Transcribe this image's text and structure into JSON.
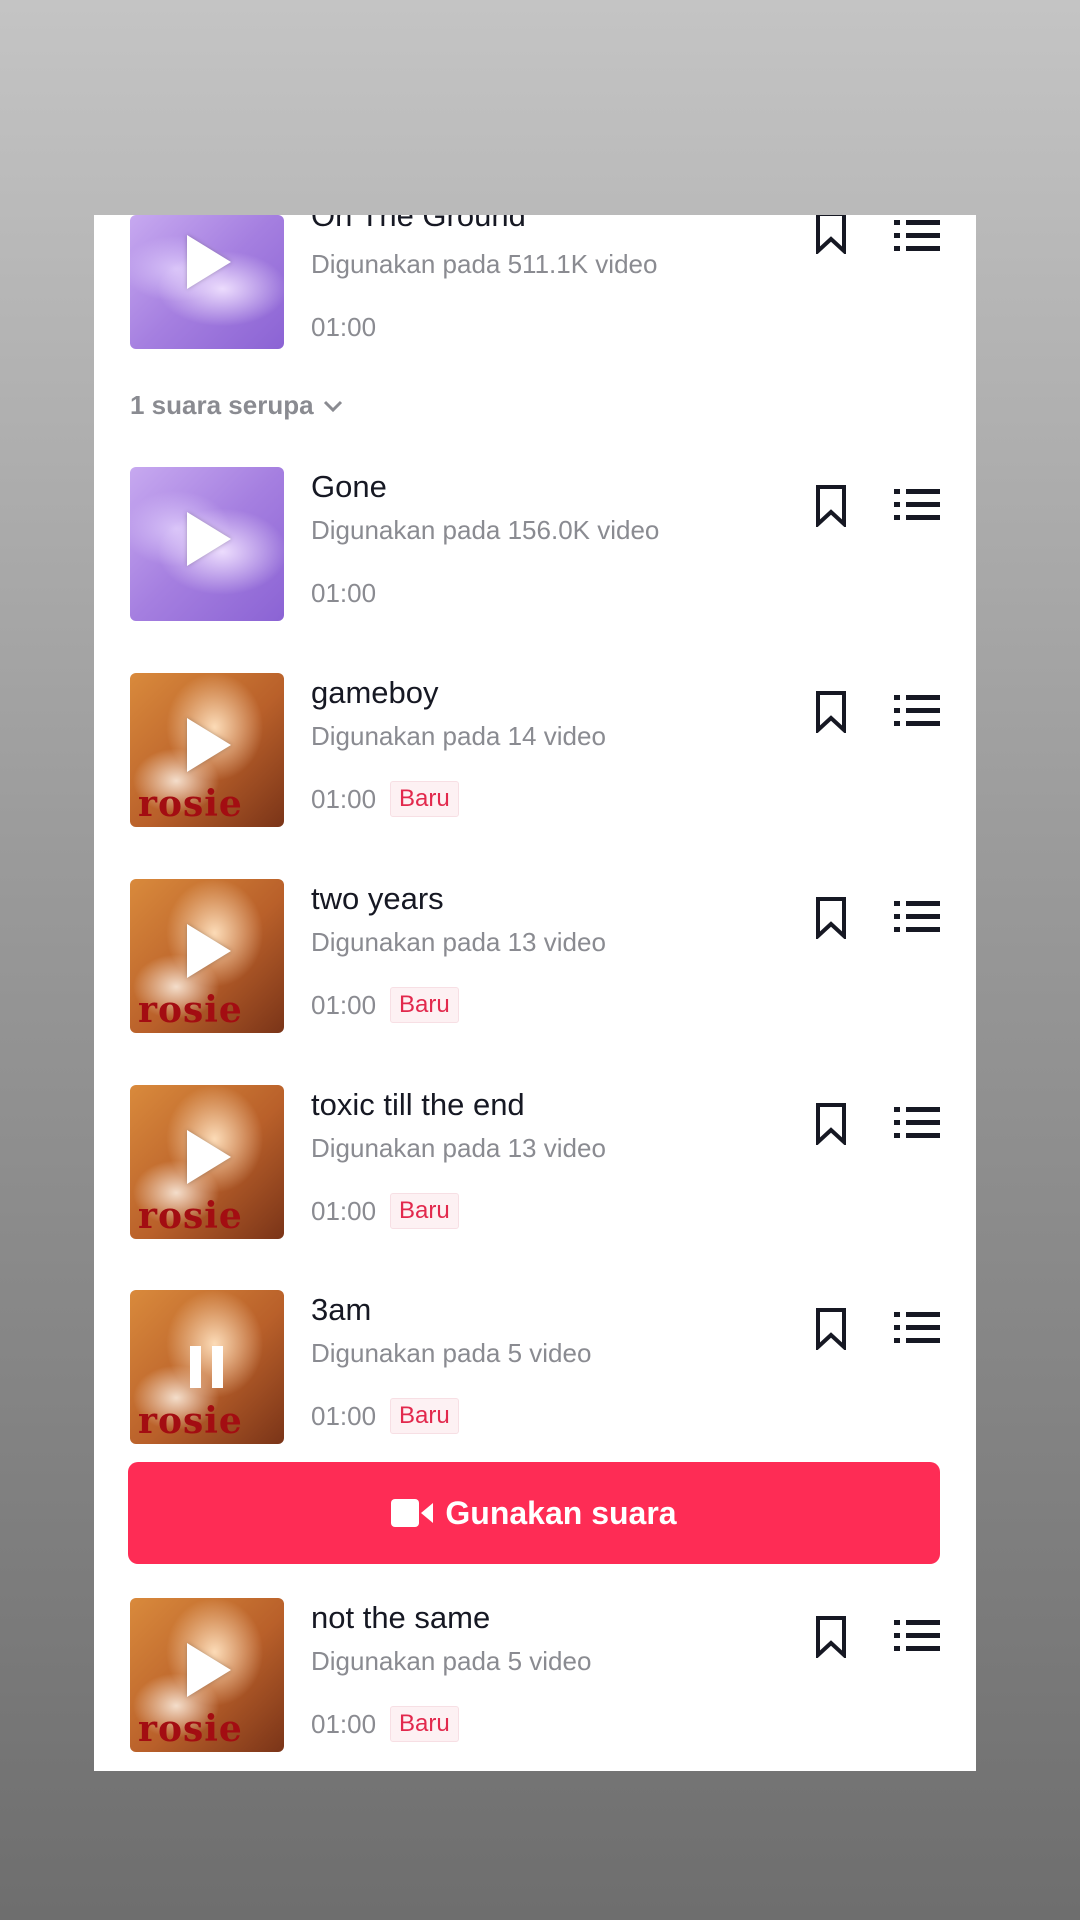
{
  "similar_toggle": {
    "label": "1 suara serupa"
  },
  "songs": [
    {
      "title": "On The Ground",
      "usage": "Digunakan pada 511.1K video",
      "duration": "01:00",
      "badge": "",
      "cover": "purple",
      "state": "play"
    },
    {
      "title": "Gone",
      "usage": "Digunakan pada 156.0K video",
      "duration": "01:00",
      "badge": "",
      "cover": "purple",
      "state": "play"
    },
    {
      "title": "gameboy",
      "usage": "Digunakan pada 14 video",
      "duration": "01:00",
      "badge": "Baru",
      "cover": "orange",
      "state": "play"
    },
    {
      "title": "two years",
      "usage": "Digunakan pada 13 video",
      "duration": "01:00",
      "badge": "Baru",
      "cover": "orange",
      "state": "play"
    },
    {
      "title": "toxic till the end",
      "usage": "Digunakan pada 13 video",
      "duration": "01:00",
      "badge": "Baru",
      "cover": "orange",
      "state": "play"
    },
    {
      "title": "3am",
      "usage": "Digunakan pada 5 video",
      "duration": "01:00",
      "badge": "Baru",
      "cover": "orange",
      "state": "pause"
    },
    {
      "title": "not the same",
      "usage": "Digunakan pada 5 video",
      "duration": "01:00",
      "badge": "Baru",
      "cover": "orange",
      "state": "play"
    }
  ],
  "cover_art_text": "rosie",
  "use_sound_button": {
    "label": "Gunakan suara",
    "icon": "video-camera-icon"
  },
  "colors": {
    "accent": "#fe2c55",
    "badge_text": "#e2294d",
    "secondary_text": "#8a8b91",
    "primary_text": "#161823"
  }
}
